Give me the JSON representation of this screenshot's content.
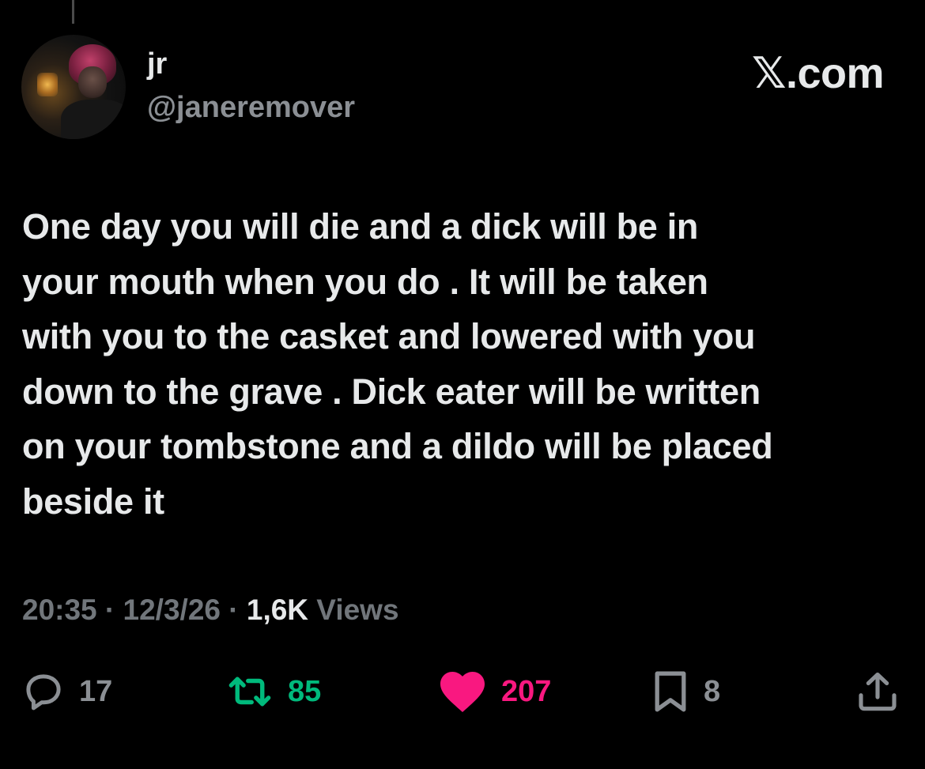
{
  "author": {
    "display_name": "jr",
    "handle": "@janeremover"
  },
  "brand": {
    "x_glyph": "𝕏",
    "suffix": ".com"
  },
  "tweet": {
    "text": "One day you will die and a dick will be in\nyour mouth when you do . It will be taken\nwith you to the casket and lowered with you\ndown to the grave . Dick eater will be written\non your tombstone and a dildo will be placed\nbeside it"
  },
  "meta": {
    "time": "20:35",
    "separator": " · ",
    "date": "12/3/26",
    "views_count": "1,6K",
    "views_label": " Views"
  },
  "actions": {
    "reply": {
      "icon": "reply-icon",
      "count": "17",
      "color": "#8b8f94"
    },
    "retweet": {
      "icon": "retweet-icon",
      "count": "85",
      "color": "#00ba7c"
    },
    "like": {
      "icon": "heart-icon",
      "count": "207",
      "color": "#f91880"
    },
    "bookmark": {
      "icon": "bookmark-icon",
      "count": "8",
      "color": "#8b8f94"
    },
    "share": {
      "icon": "share-icon",
      "color": "#8b8f94"
    }
  },
  "colors": {
    "background": "#000000",
    "text_primary": "#e7e9ea",
    "text_secondary": "#71767b"
  }
}
